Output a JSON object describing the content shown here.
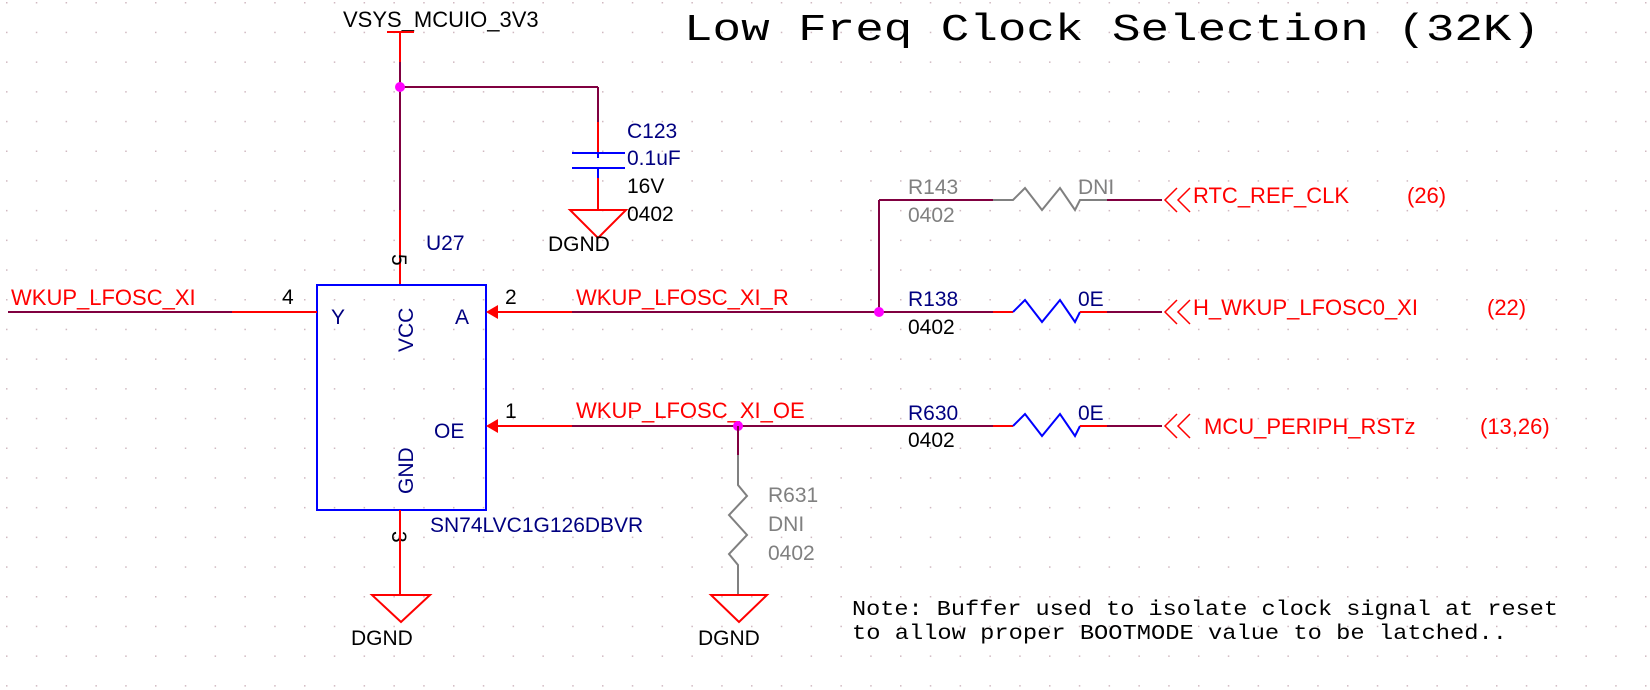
{
  "title": "Low Freq Clock Selection (32K)",
  "note": {
    "line1": "Note: Buffer used to isolate clock signal at reset",
    "line2": "to allow proper BOOTMODE value to be latched.."
  },
  "colors": {
    "wire": "#ff0000",
    "net_wire": "#800040",
    "component": "#0000ff",
    "designator": "#000080",
    "net_label": "#ff0000",
    "dni": "#808080",
    "junction": "#ff00ff",
    "grid_dot": "#d0b8c0",
    "text": "#000000"
  },
  "power": {
    "rail": "VSYS_MCUIO_3V3",
    "ground": "DGND"
  },
  "u27": {
    "designator": "U27",
    "part": "SN74LVC1G126DBVR",
    "pins": {
      "y": {
        "num": "4",
        "name": "Y"
      },
      "a": {
        "num": "2",
        "name": "A"
      },
      "oe": {
        "num": "1",
        "name": "OE"
      },
      "vcc": {
        "num": "5",
        "name": "VCC"
      },
      "gnd": {
        "num": "3",
        "name": "GND"
      }
    }
  },
  "c123": {
    "designator": "C123",
    "value": "0.1uF",
    "voltage": "16V",
    "package": "0402"
  },
  "resistors": {
    "r143": {
      "designator": "R143",
      "package": "0402",
      "value": "DNI"
    },
    "r138": {
      "designator": "R138",
      "package": "0402",
      "value": "0E"
    },
    "r630": {
      "designator": "R630",
      "package": "0402",
      "value": "0E"
    },
    "r631": {
      "designator": "R631",
      "value": "DNI",
      "package": "0402"
    }
  },
  "nets": {
    "wkup_lfosc_xi": "WKUP_LFOSC_XI",
    "wkup_lfosc_xi_r": "WKUP_LFOSC_XI_R",
    "wkup_lfosc_xi_oe": "WKUP_LFOSC_XI_OE"
  },
  "ports": [
    {
      "name": "RTC_REF_CLK",
      "ref": "(26)"
    },
    {
      "name": "H_WKUP_LFOSC0_XI",
      "ref": "(22)"
    },
    {
      "name": "MCU_PERIPH_RSTz",
      "ref": "(13,26)"
    }
  ]
}
